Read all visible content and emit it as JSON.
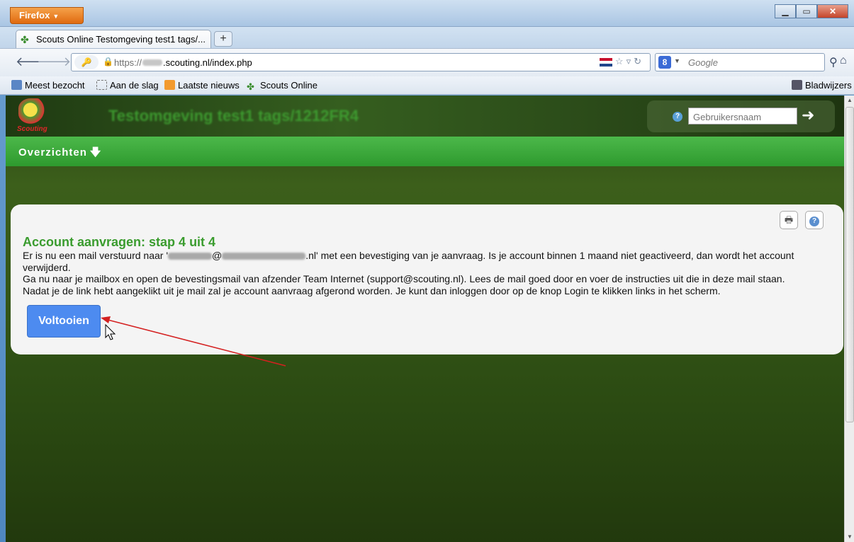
{
  "browser": {
    "menu_button": "Firefox",
    "tab_title": "Scouts Online Testomgeving test1 tags/...",
    "new_tab": "+",
    "url_prefix": "https://",
    "url_host": ".scouting.nl/index.php",
    "search_placeholder": "Google",
    "search_engine": "8"
  },
  "bookmarks": {
    "items": [
      "Meest bezocht",
      "Aan de slag",
      "Laatste nieuws",
      "Scouts Online"
    ],
    "right": "Bladwijzers"
  },
  "site": {
    "logo_text": "Scouting",
    "env_title": "Testomgeving test1 tags/1212FR4",
    "username_placeholder": "Gebruikersnaam",
    "menu": {
      "overview": "Overzichten"
    }
  },
  "content": {
    "title": "Account aanvragen: stap 4 uit 4",
    "line1_a": "Er is nu een mail verstuurd naar '",
    "line1_b": "@",
    "line1_c": ".nl' met een bevestiging van je aanvraag. Is je account binnen 1 maand niet geactiveerd, dan wordt het account verwijderd.",
    "line2": "Ga nu naar je mailbox en open de bevestingsmail van afzender Team Internet (support@scouting.nl). Lees de mail goed door en voer de instructies uit die in deze mail staan.",
    "line3": "Nadat je de link hebt aangeklikt uit je mail zal je account aanvraag afgerond worden. Je kunt dan inloggen door op de knop Login te klikken links in het scherm.",
    "button": "Voltooien"
  },
  "colors": {
    "accent_green": "#3a9c2e",
    "menu_green": "#3aa93a",
    "button_blue": "#4d8bf0",
    "annotation_red": "#d42020"
  },
  "icons": [
    "firefox-menu-icon",
    "back-icon",
    "forward-icon",
    "identity-key-icon",
    "lock-icon",
    "bookmark-star-icon",
    "reload-icon",
    "search-icon",
    "home-icon",
    "print-icon",
    "help-icon",
    "login-arrow-icon",
    "mouse-cursor-icon"
  ]
}
